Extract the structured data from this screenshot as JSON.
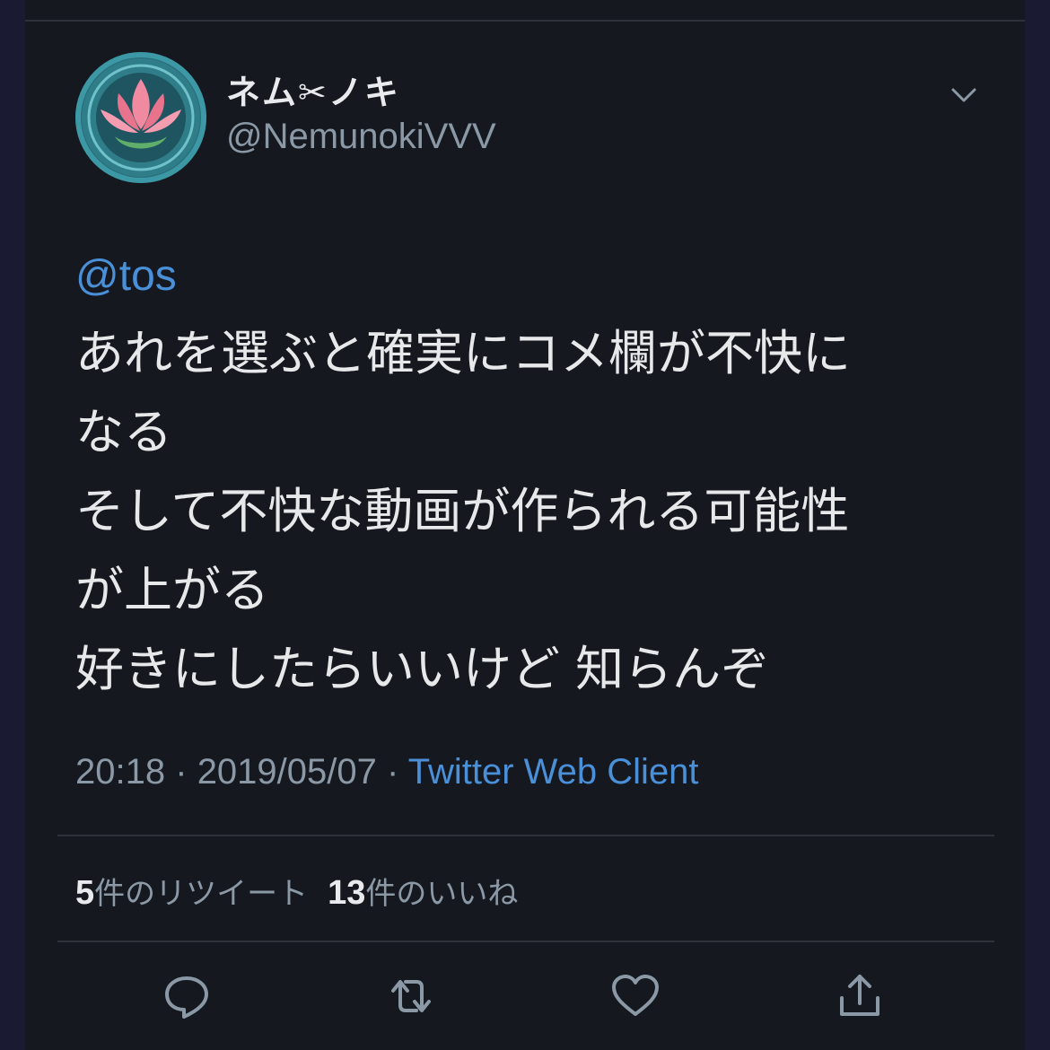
{
  "author": {
    "display_name": "ネム✂ノキ",
    "handle": "@NemunokiVVV",
    "avatar_icon": "lotus-icon"
  },
  "tweet": {
    "mention": "@tos",
    "lines": [
      "あれを選ぶと確実にコメ欄が不快に",
      "なる",
      "そして不快な動画が作られる可能性",
      "が上がる",
      "好きにしたらいいけど 知らんぞ"
    ]
  },
  "meta": {
    "time": "20:18",
    "separator": "·",
    "date": "2019/05/07",
    "client": "Twitter Web Client"
  },
  "stats": {
    "retweets_count": "5",
    "retweets_label": "件のリツイート",
    "likes_count": "13",
    "likes_label": "件のいいね"
  },
  "actions": [
    "reply-icon",
    "retweet-icon",
    "like-icon",
    "share-icon"
  ],
  "colors": {
    "background": "#15181f",
    "outer": "#1b1a33",
    "link": "#4a90d9",
    "text": "#e6e8ea",
    "secondary": "#8b98a5"
  }
}
